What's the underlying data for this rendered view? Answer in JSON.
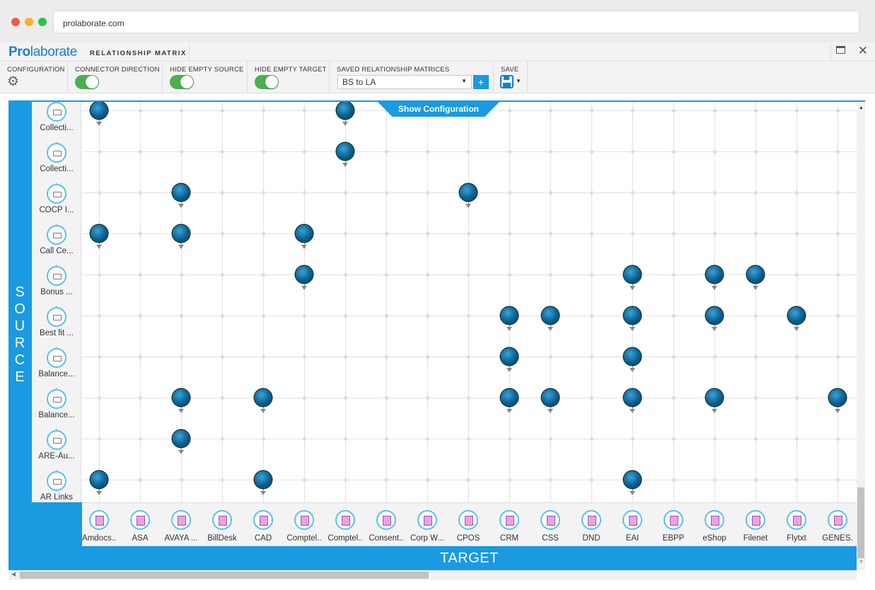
{
  "browser": {
    "url": "prolaborate.com"
  },
  "app": {
    "brand_bold": "Pro",
    "brand_rest": "laborate",
    "title": "RELATIONSHIP MATRIX"
  },
  "toolbar": {
    "configuration_label": "CONFIGURATION",
    "connector_direction_label": "CONNECTOR DIRECTION",
    "connector_direction_on": true,
    "hide_empty_source_label": "HIDE EMPTY SOURCE",
    "hide_empty_source_on": true,
    "hide_empty_target_label": "HIDE EMPTY TARGET",
    "hide_empty_target_on": true,
    "saved_matrices_label": "SAVED RELATIONSHIP MATRICES",
    "saved_matrices_value": "BS to LA",
    "add_label": "+",
    "save_label": "SAVE"
  },
  "show_configuration": "Show Configuration",
  "source_label": "SOURCE",
  "target_label": "TARGET",
  "sources": [
    "Collecti...",
    "Collecti...",
    "COCP I...",
    "Call Ce...",
    "Bonus ...",
    "Best fit ...",
    "Balance...",
    "Balance...",
    "ARE-Au...",
    "AR Links"
  ],
  "targets": [
    "Amdocs..",
    "ASA",
    "AVAYA ...",
    "BillDesk",
    "CAD",
    "Comptel..",
    "Comptel..",
    "Consent..",
    "Corp W...",
    "CPOS",
    "CRM",
    "CSS",
    "DND",
    "EAI",
    "EBPP",
    "eShop",
    "Filenet",
    "Flytxt",
    "GENES."
  ],
  "relationships": [
    [
      0,
      0
    ],
    [
      0,
      6
    ],
    [
      1,
      6
    ],
    [
      2,
      2
    ],
    [
      2,
      9
    ],
    [
      3,
      0
    ],
    [
      3,
      2
    ],
    [
      3,
      5
    ],
    [
      4,
      5
    ],
    [
      4,
      13
    ],
    [
      4,
      15
    ],
    [
      4,
      16
    ],
    [
      5,
      10
    ],
    [
      5,
      11
    ],
    [
      5,
      13
    ],
    [
      5,
      15
    ],
    [
      5,
      17
    ],
    [
      6,
      10
    ],
    [
      6,
      13
    ],
    [
      7,
      2
    ],
    [
      7,
      4
    ],
    [
      7,
      10
    ],
    [
      7,
      11
    ],
    [
      7,
      13
    ],
    [
      7,
      15
    ],
    [
      7,
      18
    ],
    [
      8,
      2
    ],
    [
      9,
      0
    ],
    [
      9,
      4
    ],
    [
      9,
      13
    ]
  ],
  "icons": {
    "gear": "gear-icon",
    "save": "floppy-disk-icon",
    "close": "close-icon",
    "maximize": "maximize-icon"
  }
}
